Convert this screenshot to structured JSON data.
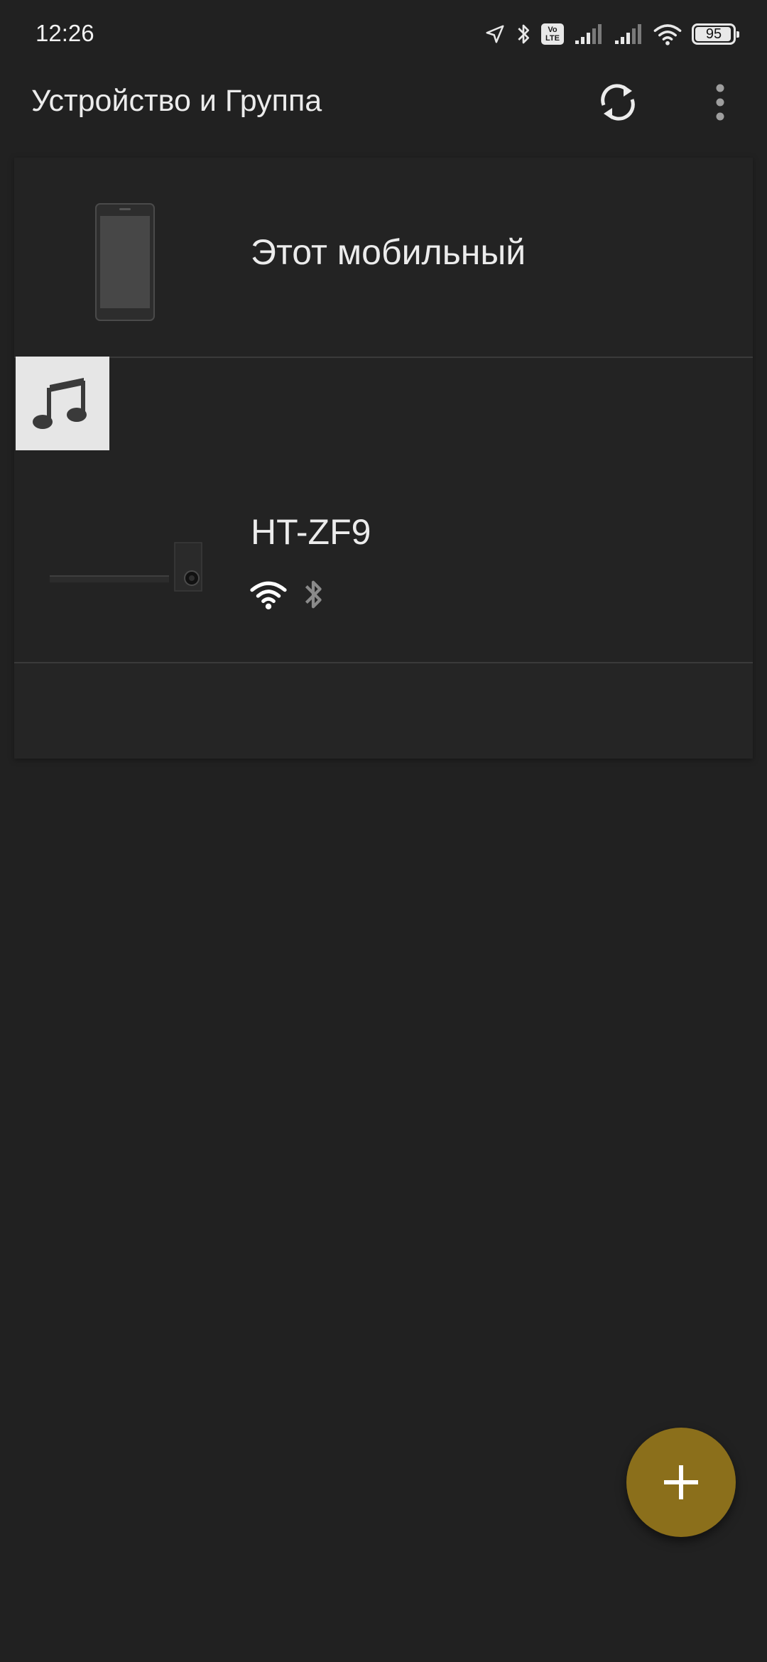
{
  "status_bar": {
    "time": "12:26",
    "icons": [
      "location-arrow-icon",
      "bluetooth-icon",
      "volte-icon",
      "signal-icon",
      "signal-icon",
      "wifi-icon",
      "battery-icon"
    ],
    "volte_line1": "Vo",
    "volte_line2": "LTE",
    "battery_level": "95"
  },
  "appbar": {
    "title": "Устройство и Группа",
    "actions": [
      "refresh-icon",
      "more-vert-icon"
    ]
  },
  "devices": [
    {
      "name": "Этот мобильный",
      "image": "phone",
      "source_icon": "music-note-icon"
    },
    {
      "name": "HT-ZF9",
      "image": "soundbar-subwoofer",
      "status_icons": [
        "wifi-icon",
        "bluetooth-icon"
      ]
    }
  ],
  "fab": {
    "icon": "plus-icon",
    "color": "#8b6f1b"
  },
  "colors": {
    "background": "#212121",
    "card": "#232323",
    "accent": "#8b6f1b"
  }
}
